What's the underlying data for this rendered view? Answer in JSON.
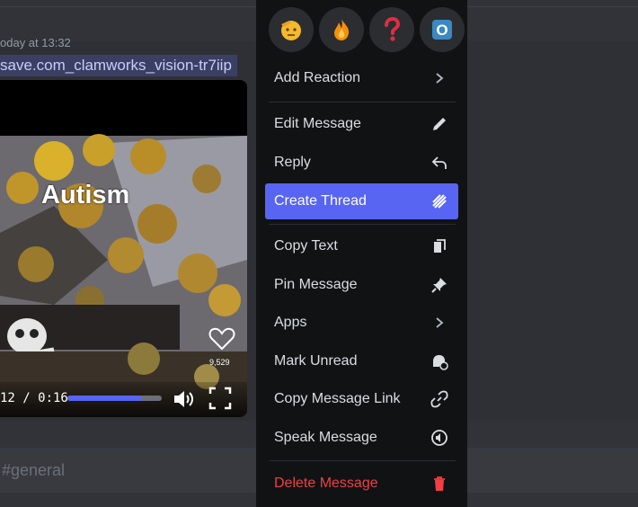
{
  "message": {
    "timestamp": "oday at 13:32",
    "file_name": "save.com_clamworks_vision-tr7iip"
  },
  "video": {
    "caption": "Autism",
    "likes": "9,529",
    "time": "12 / 0:16",
    "progress_fraction": 0.79
  },
  "input": {
    "placeholder": "#general"
  },
  "reactions": [
    {
      "icon": "saluting-face-icon"
    },
    {
      "icon": "fire-icon"
    },
    {
      "icon": "red-question-mark-icon"
    },
    {
      "icon": "o-button-icon",
      "text": "O"
    }
  ],
  "menu": {
    "add_reaction": "Add Reaction",
    "edit_message": "Edit Message",
    "reply": "Reply",
    "create_thread": "Create Thread",
    "copy_text": "Copy Text",
    "pin_message": "Pin Message",
    "apps": "Apps",
    "mark_unread": "Mark Unread",
    "copy_message_link": "Copy Message Link",
    "speak_message": "Speak Message",
    "delete_message": "Delete Message"
  },
  "colors": {
    "accent": "#5865f2",
    "danger": "#f23f43",
    "menu_bg": "#111214",
    "chat_bg": "#313338"
  }
}
